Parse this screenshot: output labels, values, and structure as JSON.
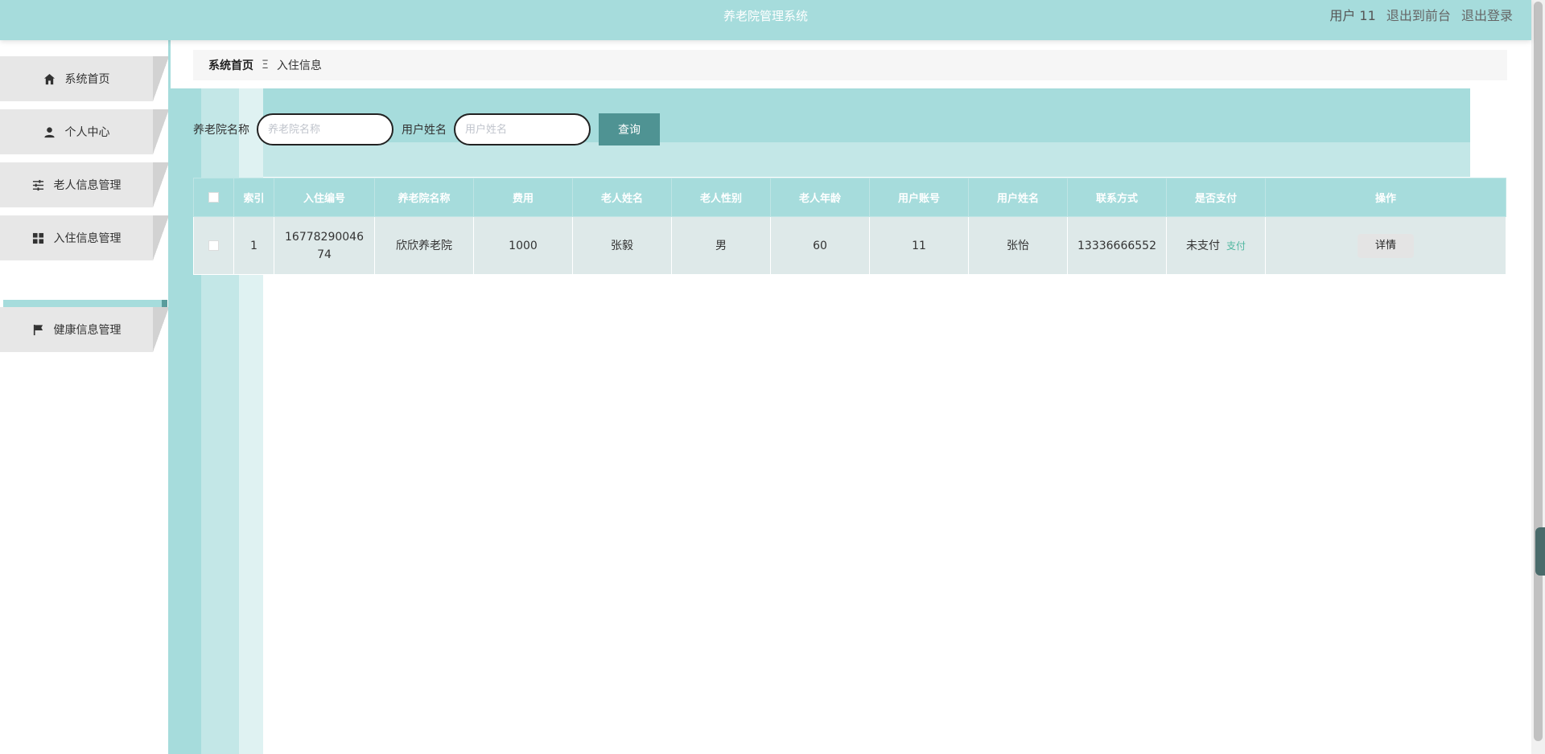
{
  "header": {
    "app_title": "养老院管理系统",
    "user_label": "用户 11",
    "back_to_front": "退出到前台",
    "logout": "退出登录"
  },
  "sidebar": {
    "items": [
      {
        "label": "系统首页",
        "icon": "home-icon"
      },
      {
        "label": "个人中心",
        "icon": "user-icon"
      },
      {
        "label": "老人信息管理",
        "icon": "sliders-icon"
      },
      {
        "label": "入住信息管理",
        "icon": "grid-icon"
      },
      {
        "label": "健康信息管理",
        "icon": "flag-icon"
      }
    ],
    "submenu_active": "入住信息"
  },
  "breadcrumb": {
    "home": "系统首页",
    "separator": "Ξ",
    "current": "入住信息"
  },
  "search": {
    "label1": "养老院名称",
    "placeholder1": "养老院名称",
    "label2": "用户姓名",
    "placeholder2": "用户姓名",
    "button": "查询"
  },
  "table": {
    "headers": [
      "索引",
      "入住编号",
      "养老院名称",
      "费用",
      "老人姓名",
      "老人性别",
      "老人年龄",
      "用户账号",
      "用户姓名",
      "联系方式",
      "是否支付",
      "操作"
    ],
    "rows": [
      {
        "index": "1",
        "checkin_no": "1677829004674",
        "home_name": "欣欣养老院",
        "fee": "1000",
        "elder_name": "张毅",
        "elder_gender": "男",
        "elder_age": "60",
        "user_account": "11",
        "user_name": "张怡",
        "contact": "13336666552",
        "pay_status": "未支付",
        "pay_link": "支付",
        "action": "详情"
      }
    ]
  },
  "colors": {
    "primary": "#a6dcdc",
    "button": "#4f9393",
    "pay_link": "#4fb7a0"
  }
}
